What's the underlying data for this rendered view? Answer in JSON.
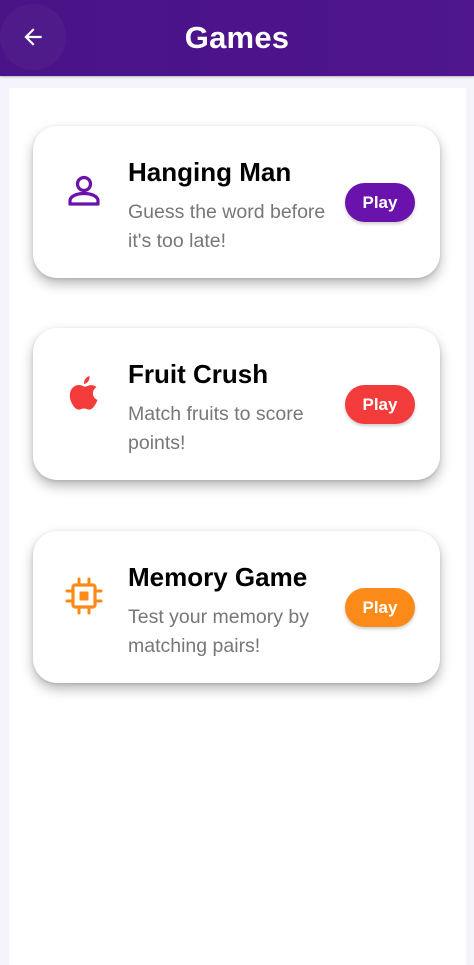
{
  "header": {
    "title": "Games",
    "back_icon": "arrow-left-icon",
    "background": "#4b1489"
  },
  "games": [
    {
      "title": "Hanging Man",
      "description": "Guess the word before it's too late!",
      "play_label": "Play",
      "icon": "person-icon",
      "accent": "#6a13ac"
    },
    {
      "title": "Fruit Crush",
      "description": "Match fruits to score points!",
      "play_label": "Play",
      "icon": "apple-icon",
      "accent": "#f43b3b"
    },
    {
      "title": "Memory Game",
      "description": "Test your memory by matching pairs!",
      "play_label": "Play",
      "icon": "chip-icon",
      "accent": "#fb8a18"
    }
  ]
}
